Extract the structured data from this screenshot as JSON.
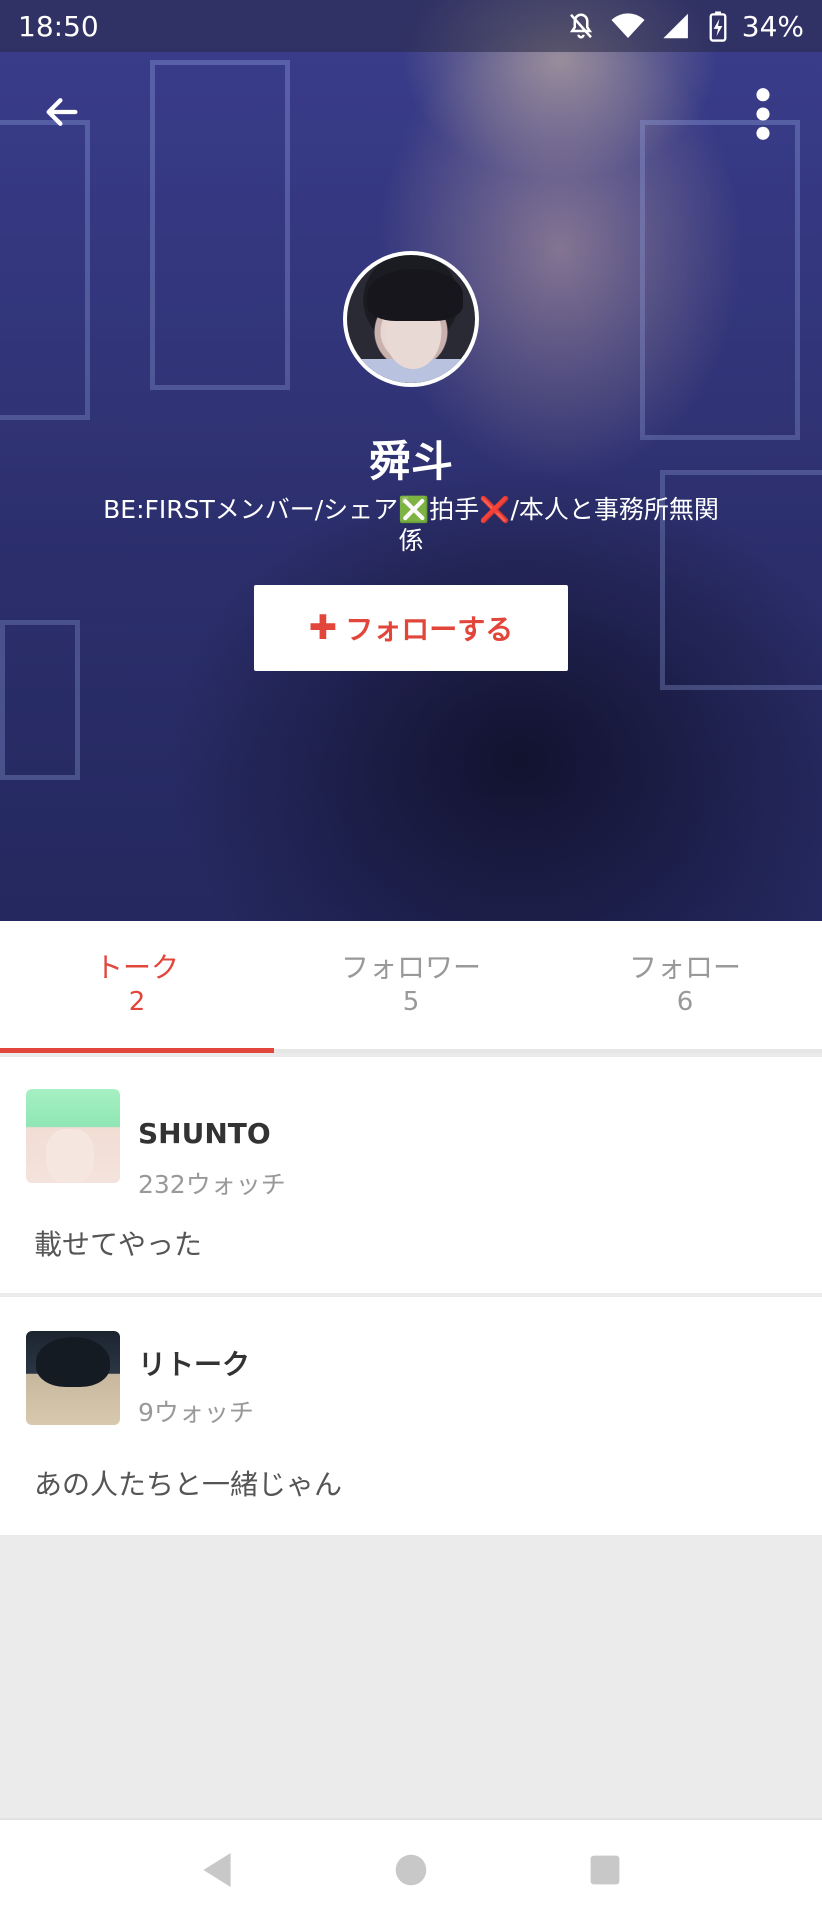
{
  "status_bar": {
    "time": "18:50",
    "battery_percent": "34%",
    "icons": [
      "bell-off-icon",
      "wifi-icon",
      "signal-icon",
      "battery-charging-icon"
    ]
  },
  "header": {
    "back_icon": "arrow-left-icon",
    "more_icon": "more-vertical-icon"
  },
  "profile": {
    "name": "舜斗",
    "bio": "BE:FIRSTメンバー/シェア❎拍手❌/本人と事務所無関\n係",
    "follow_label": "フォローする",
    "follow_icon": "plus-icon"
  },
  "tabs": [
    {
      "label": "トーク",
      "count": "2",
      "active": true
    },
    {
      "label": "フォロワー",
      "count": "5",
      "active": false
    },
    {
      "label": "フォロー",
      "count": "6",
      "active": false
    }
  ],
  "posts": [
    {
      "username": "SHUNTO",
      "watch": "232ウォッチ",
      "text": "載せてやった"
    },
    {
      "username": "リトーク",
      "watch": "9ウォッチ",
      "text": "あの人たちと一緒じゃん"
    }
  ],
  "colors": {
    "accent": "#e2453a",
    "muted_text": "#999999",
    "background": "#ebebeb"
  },
  "nav_bar": {
    "icons": [
      "back-triangle-icon",
      "home-circle-icon",
      "recents-square-icon"
    ]
  }
}
